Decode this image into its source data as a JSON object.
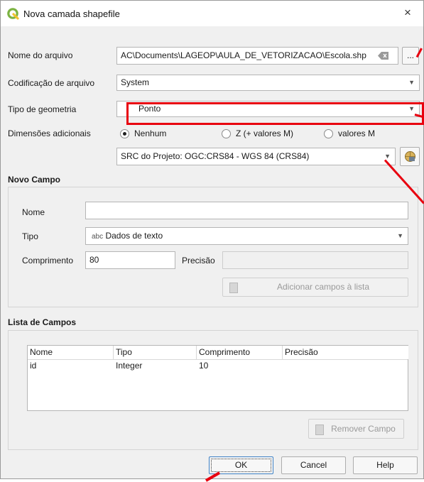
{
  "window": {
    "title": "Nova camada shapefile",
    "close": "×"
  },
  "form": {
    "filename_label": "Nome do arquivo",
    "filename_value": "AC\\Documents\\LAGEOP\\AULA_DE_VETORIZACAO\\Escola.shp",
    "browse_label": "...",
    "encoding_label": "Codificação de arquivo",
    "encoding_value": "System",
    "geometry_label": "Tipo de geometria",
    "geometry_value": "Ponto",
    "dimensions_label": "Dimensões adicionais",
    "dim_none": "Nenhum",
    "dim_z": "Z (+ valores M)",
    "dim_m": "valores M",
    "dim_selected": "Nenhum",
    "crs_value": "SRC do Projeto: OGC:CRS84 - WGS 84 (CRS84)"
  },
  "new_field": {
    "title": "Novo Campo",
    "name_label": "Nome",
    "name_value": "",
    "type_label": "Tipo",
    "type_prefix": "abc",
    "type_value": "Dados de texto",
    "length_label": "Comprimento",
    "length_value": "80",
    "precision_label": "Precisão",
    "precision_value": "",
    "add_button": "Adicionar campos à lista"
  },
  "field_list": {
    "title": "Lista de Campos",
    "headers": [
      "Nome",
      "Tipo",
      "Comprimento",
      "Precisão"
    ],
    "rows": [
      {
        "name": "id",
        "type": "Integer",
        "length": "10",
        "precision": ""
      }
    ],
    "remove_button": "Remover Campo"
  },
  "buttons": {
    "ok": "OK",
    "cancel": "Cancel",
    "help": "Help"
  },
  "colors": {
    "annotation": "#e8000f",
    "qgis_green": "#7cb342",
    "qgis_yellow": "#f2c230"
  }
}
